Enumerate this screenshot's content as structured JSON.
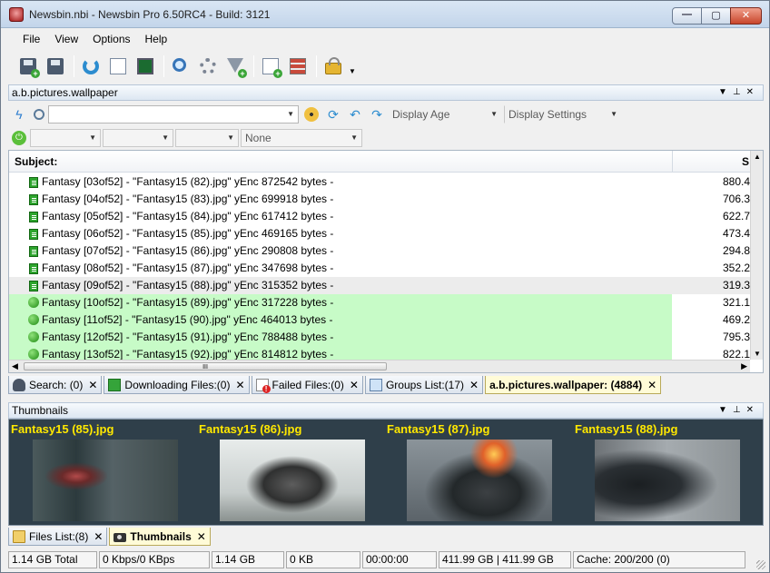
{
  "window": {
    "title": "Newsbin.nbi - Newsbin Pro 6.50RC4 - Build: 3121",
    "controls": [
      "minimize",
      "maximize",
      "close"
    ]
  },
  "menu": [
    "File",
    "View",
    "Options",
    "Help"
  ],
  "toolbar_icons": [
    "save-add-icon",
    "save-icon",
    "refresh-icon",
    "server-icon",
    "monitor-icon",
    "zoom-icon",
    "gear-icon",
    "filter-icon",
    "doc-add-icon",
    "list-add-icon",
    "lock-icon"
  ],
  "group_panel": {
    "title": "a.b.pictures.wallpaper",
    "search_placeholder": "",
    "age_label": "Display Age",
    "settings_label": "Display Settings",
    "filter4": "None"
  },
  "grid": {
    "col_subject": "Subject:",
    "col_size": "S",
    "rows": [
      {
        "icon": "file",
        "text": "Fantasy [03of52] - \"Fantasy15 (82).jpg\" yEnc  872542 bytes  -",
        "size": "880.4",
        "state": "normal"
      },
      {
        "icon": "file",
        "text": "Fantasy [04of52] - \"Fantasy15 (83).jpg\" yEnc  699918 bytes  -",
        "size": "706.3",
        "state": "normal"
      },
      {
        "icon": "file",
        "text": "Fantasy [05of52] - \"Fantasy15 (84).jpg\" yEnc  617412 bytes  -",
        "size": "622.7",
        "state": "normal"
      },
      {
        "icon": "file",
        "text": "Fantasy [06of52] - \"Fantasy15 (85).jpg\" yEnc  469165 bytes  -",
        "size": "473.4",
        "state": "normal"
      },
      {
        "icon": "file",
        "text": "Fantasy [07of52] - \"Fantasy15 (86).jpg\" yEnc  290808 bytes  -",
        "size": "294.8",
        "state": "normal"
      },
      {
        "icon": "file",
        "text": "Fantasy [08of52] - \"Fantasy15 (87).jpg\" yEnc  347698 bytes  -",
        "size": "352.2",
        "state": "normal"
      },
      {
        "icon": "file",
        "text": "Fantasy [09of52] - \"Fantasy15 (88).jpg\" yEnc  315352 bytes  -",
        "size": "319.3",
        "state": "selected"
      },
      {
        "icon": "ball",
        "text": "Fantasy [10of52] - \"Fantasy15 (89).jpg\" yEnc  317228 bytes  -",
        "size": "321.1",
        "state": "green"
      },
      {
        "icon": "ball",
        "text": "Fantasy [11of52] - \"Fantasy15 (90).jpg\" yEnc  464013 bytes  -",
        "size": "469.2",
        "state": "green"
      },
      {
        "icon": "ball",
        "text": "Fantasy [12of52] - \"Fantasy15 (91).jpg\" yEnc  788488 bytes  -",
        "size": "795.3",
        "state": "green"
      },
      {
        "icon": "ball",
        "text": "Fantasy [13of52] - \"Fantasy15 (92).jpg\" yEnc  814812 bytes  -",
        "size": "822.1",
        "state": "green"
      }
    ],
    "scroll_grip": "III"
  },
  "tabs_top": [
    {
      "icon": "binoculars",
      "label": "Search: (0)",
      "active": false
    },
    {
      "icon": "download",
      "label": "Downloading Files:(0)",
      "active": false
    },
    {
      "icon": "failed",
      "label": "Failed Files:(0)",
      "active": false
    },
    {
      "icon": "groups",
      "label": "Groups List:(17)",
      "active": false
    },
    {
      "icon": "none",
      "label": "a.b.pictures.wallpaper: (4884)",
      "active": true
    }
  ],
  "thumbnails": {
    "title": "Thumbnails",
    "items": [
      {
        "caption": "Fantasy15 (85).jpg"
      },
      {
        "caption": "Fantasy15 (86).jpg"
      },
      {
        "caption": "Fantasy15 (87).jpg"
      },
      {
        "caption": "Fantasy15 (88).jpg"
      }
    ]
  },
  "tabs_bottom": [
    {
      "icon": "folder",
      "label": "Files List:(8)",
      "active": false
    },
    {
      "icon": "camera",
      "label": "Thumbnails",
      "active": true
    }
  ],
  "status": [
    "1.14 GB Total",
    "0 Kbps/0 KBps",
    "1.14 GB",
    "0 KB",
    "00:00:00",
    "411.99 GB | 411.99 GB",
    "Cache: 200/200 (0)"
  ],
  "colors": {
    "green_row": "#c7fbc7",
    "thumb_caption": "#ffe800",
    "thumb_bg": "#2f3f4a",
    "active_tab": "#fffbd7"
  }
}
